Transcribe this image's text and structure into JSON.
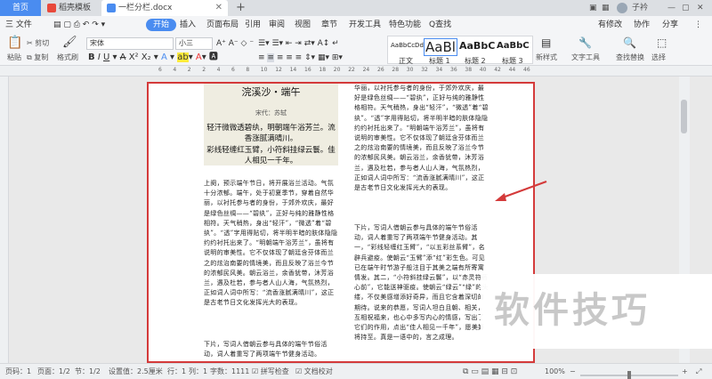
{
  "tabs": {
    "home": "首页",
    "doc1": "稻壳模板",
    "doc2": "一栏分栏.docx",
    "new_tab": "+",
    "user": "子衿"
  },
  "menubar": {
    "file": "三 文件",
    "items": [
      "开始",
      "插入",
      "页面布局",
      "引用",
      "审阅",
      "视图",
      "章节",
      "开发工具",
      "特色功能"
    ],
    "search": "Q查找",
    "unsaved": "有修改",
    "collab": "协作",
    "share": "分享"
  },
  "ribbon": {
    "paste": "粘贴",
    "cut": "剪切",
    "copy": "复制",
    "format_painter": "格式刷",
    "font_name": "宋体",
    "font_size": "小三",
    "styles": [
      {
        "sample": "AaBbCcDd",
        "label": "正文"
      },
      {
        "sample": "AaBl",
        "label": "标题 1"
      },
      {
        "sample": "AaBbC",
        "label": "标题 2"
      },
      {
        "sample": "AaBbC",
        "label": "标题 3"
      }
    ],
    "new_style": "新样式",
    "text_tool": "文字工具",
    "find_replace": "查找替换",
    "select": "选择"
  },
  "ruler_numbers": [
    "6",
    "4",
    "2",
    "2",
    "4",
    "6",
    "8",
    "10",
    "12",
    "14",
    "16",
    "18",
    "20",
    "22",
    "24",
    "26",
    "28",
    "30",
    "32",
    "34",
    "36",
    "38",
    "40",
    "42",
    "44",
    "46"
  ],
  "poem": {
    "title": "浣溪沙・端午",
    "author": "宋代：苏轼",
    "lines": [
      "轻汗微微透碧纨，明朝端午浴芳兰。流香涨腻满晴川。",
      "彩线轻缠红玉臂，小符斜挂绿云鬟。佳人相见一千年。"
    ]
  },
  "left_column": "上阕，预示端午节日，将开展浴兰活动。气氛十分浓郁。端午，处于初夏季节，穿着自然华丽，以衬托参与者的身份，于郊外欢庆，最好是绿色丝绸——“碧纨”，正好与纯的雅静性格相符。天气稍热，身出“轻汗”，“微透”着“碧纨”。“透”字用得贴切，将半明半暗的肤体隐隐约约衬托出来了。“明朝端午浴芳兰”，虽将有说明的审美性。它不仅体现了朝廷含芬体而兰之的炫治南要的情境美，而且反映了浴兰今节的浓郁民风美。朝云浴兰，余香犹带，沐芳浴兰，遇及杜若，参与者人山人海，气氛热烈，正如词人词中所写：“流香涨腻满晴川”，这正是古老节日文化发挥光大的表现。",
  "left_column_tail": "下片，写词人借朝云参与具体的端午节俗活动，词人着重写了两项端午节健身活动。",
  "right_column": "华丽，以衬托参与者的身份，于郊外欢庆，最好是绿色丝绸——“碧纨”，正好与纯的雅静性格相符。天气稍热，身出“轻汗”，“微透”着“碧纨”。“透”字用得贴切，将半明半暗的肤体隐隐约约衬托出来了。“明朝端午浴芳兰”，虽将有说明的审美性。它不仅体现了朝廷含芬体而兰之的炫治南要的情境美，而且反映了浴兰今节的浓郁民风美。朝云浴兰，余香犹带，沐芳浴兰，遇及杜若，参与者人山人海，气氛热烈，正如词人词中所写：“流香涨腻满晴川”，这正是古老节日文化发挥光大的表现。",
  "right_column_tail": "下片，写词人借朝云参与具体的端午节俗活动，词人着重写了两项端午节健身活动。其一，“彩线轻缠红玉臂”，“以五彩丝系臂”，名辟兵避疫。使朝云“玉臂”添“红”彩生色。可见已在端午时节游子般注目于其美之端有所寄寓情发。其二，“小符斜挂绿云鬟”，以“赤灵符著心前”，它能送神驱疫。使朝云“绿云”“绿”的头缕，不仅美感增添好奇异，而且它含着深切的期待。说来的恭愿，写词人坦白且朝、相关，互相祝福来，也心中多写内心的情感，写出了它们的作用，点出“佳人相见一千年”，愿美好将持至。真是一语中的，言之成理。",
  "status": {
    "page": "页码：1",
    "pages": "页面：1/2",
    "section": "节：1/2",
    "setting": "设置值：2.5厘米",
    "row": "行：1",
    "col": "列：1",
    "words": "字数：1111",
    "spell": "拼写检查",
    "doc_check": "文档校对",
    "zoom": "100%"
  },
  "watermark": "软件技巧",
  "colors": {
    "accent": "#4a8cf0",
    "highlight_border": "#d43a3a",
    "arrow": "#d43a3a",
    "poem_bg": "#efede1"
  }
}
